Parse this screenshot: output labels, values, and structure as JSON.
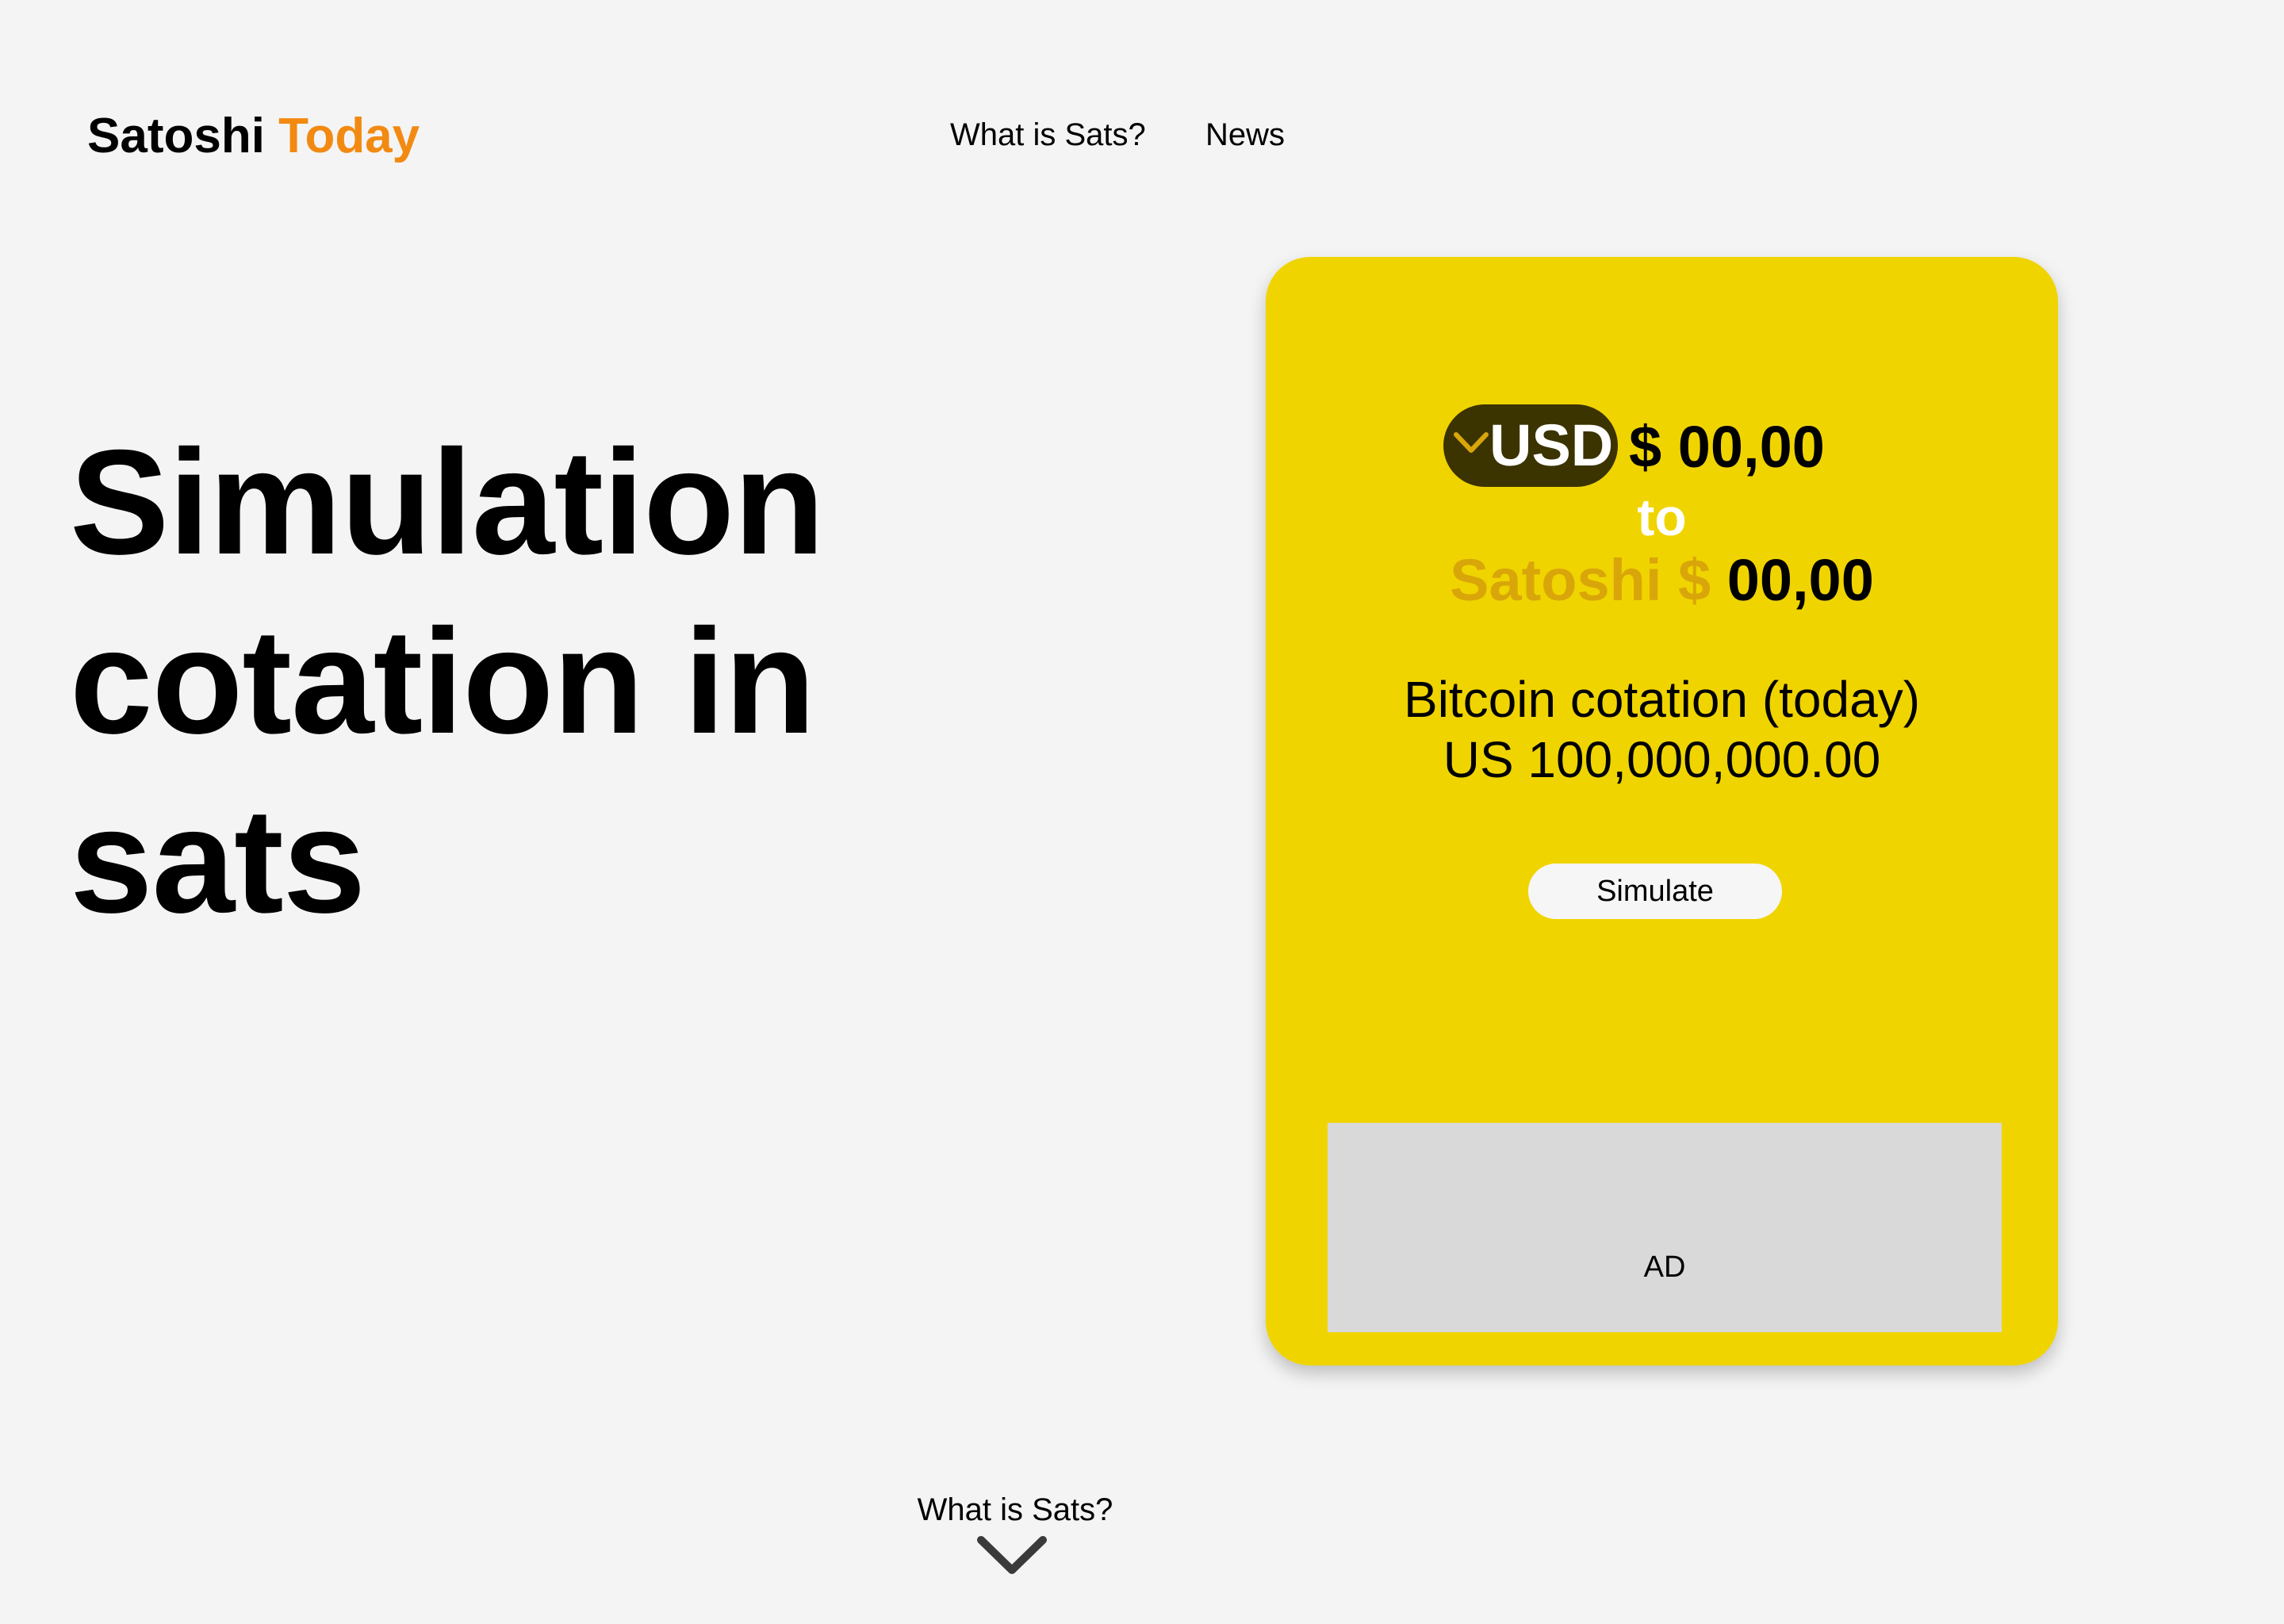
{
  "header": {
    "logo_main": "Satoshi",
    "logo_accent": "Today",
    "nav": {
      "what_is_sats": "What is Sats?",
      "news": "News"
    }
  },
  "hero": {
    "line1": "Simulation",
    "line2": "cotation in",
    "line3": "sats"
  },
  "converter": {
    "currency": "USD",
    "currency_icon": "chevron-down-icon",
    "usd_amount": "$ 00,00",
    "to_label": "to",
    "satoshi_label": "Satoshi $",
    "satoshi_amount": "00,00",
    "cotation_title": "Bitcoin cotation (today)",
    "cotation_value": "US 100,000,000.00",
    "simulate_label": "Simulate",
    "ad_label": "AD"
  },
  "footer": {
    "link_label": "What is Sats?",
    "icon": "chevron-down-icon"
  },
  "colors": {
    "background": "#f4f4f4",
    "accent_orange": "#f28a12",
    "card_yellow": "#f0d400",
    "pill_dark": "#3b3300",
    "satoshi_gold": "#d9a60a",
    "ad_gray": "#d9d9d9"
  }
}
